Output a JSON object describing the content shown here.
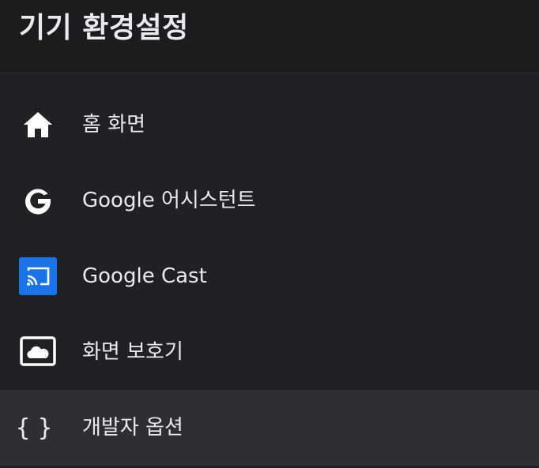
{
  "header": {
    "title": "기기 환경설정"
  },
  "menu": {
    "items": [
      {
        "label": "홈 화면",
        "icon": "home-icon"
      },
      {
        "label": "Google 어시스턴트",
        "icon": "google-g-icon"
      },
      {
        "label": "Google Cast",
        "icon": "cast-icon"
      },
      {
        "label": "화면 보호기",
        "icon": "screensaver-icon"
      },
      {
        "label": "개발자 옵션",
        "icon": "braces-icon",
        "selected": true
      }
    ]
  },
  "colors": {
    "background": "#202124",
    "header_background": "#1b1c1e",
    "selected_background": "#2e2f32",
    "cast_accent": "#1a73e8",
    "text": "#e8eaed"
  }
}
